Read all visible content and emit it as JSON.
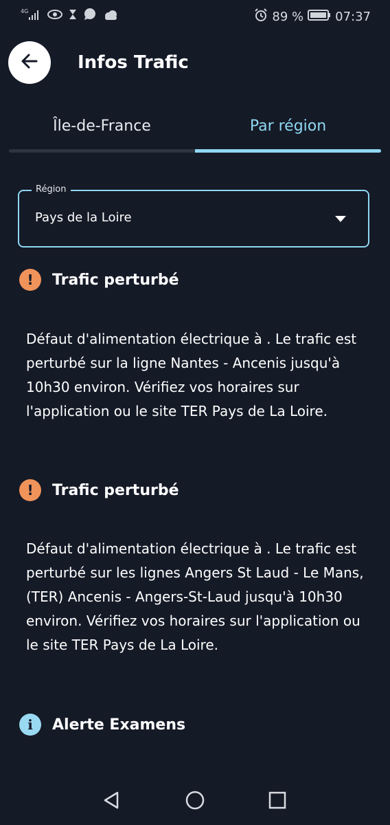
{
  "status_bar": {
    "network": "4G",
    "battery_percent": "89 %",
    "time": "07:37"
  },
  "header": {
    "title": "Infos Trafic"
  },
  "tabs": [
    {
      "label": "Île-de-France",
      "selected": false
    },
    {
      "label": "Par région",
      "selected": true
    }
  ],
  "region": {
    "label": "Région",
    "value": "Pays de la Loire"
  },
  "alerts": [
    {
      "type": "warning",
      "title": "Trafic perturbé",
      "body": "Défaut d'alimentation électrique à . Le trafic est perturbé sur la ligne Nantes - Ancenis jusqu'à 10h30 environ. Vérifiez vos horaires sur l'application ou le site TER Pays de La Loire."
    },
    {
      "type": "warning",
      "title": "Trafic perturbé",
      "body": "Défaut d'alimentation électrique à . Le trafic est perturbé sur les lignes Angers St Laud - Le Mans, (TER) Ancenis - Angers-St-Laud jusqu'à 10h30 environ. Vérifiez vos horaires sur l'application ou le site TER Pays de La Loire."
    },
    {
      "type": "info",
      "title": "Alerte Examens"
    }
  ],
  "colors": {
    "background": "#151a27",
    "accent": "#8fd8f2",
    "warning": "#f0935a",
    "info": "#9ad9f2"
  },
  "icons": {
    "back": "arrow-left-icon",
    "dropdown": "triangle-down-icon",
    "warning": "exclamation-circle-icon",
    "info": "info-circle-icon",
    "nav_back": "triangle-left-icon",
    "nav_home": "circle-icon",
    "nav_recents": "square-icon"
  }
}
